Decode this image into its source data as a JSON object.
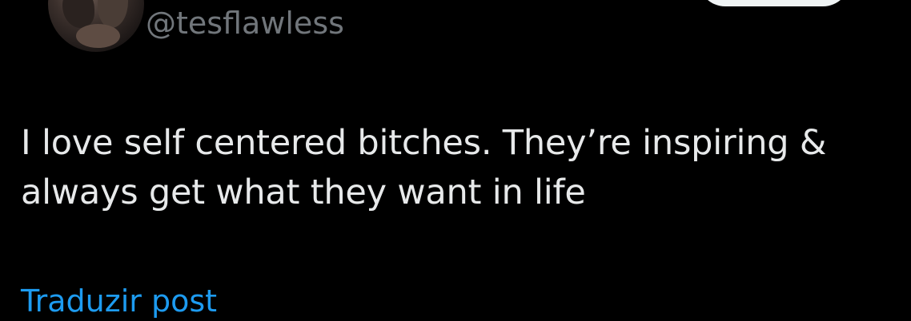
{
  "author": {
    "handle": "@tesflawless",
    "avatar_icon": "avatar-photo"
  },
  "tweet": {
    "text": "I love self centered bitches. They’re inspiring & always get what they want in life"
  },
  "actions": {
    "translate_label": "Traduzir post",
    "follow_button_color": "#eff3f4"
  },
  "colors": {
    "background": "#000000",
    "text_primary": "#e7e9ea",
    "text_secondary": "#71767b",
    "link": "#1d9bf0"
  }
}
